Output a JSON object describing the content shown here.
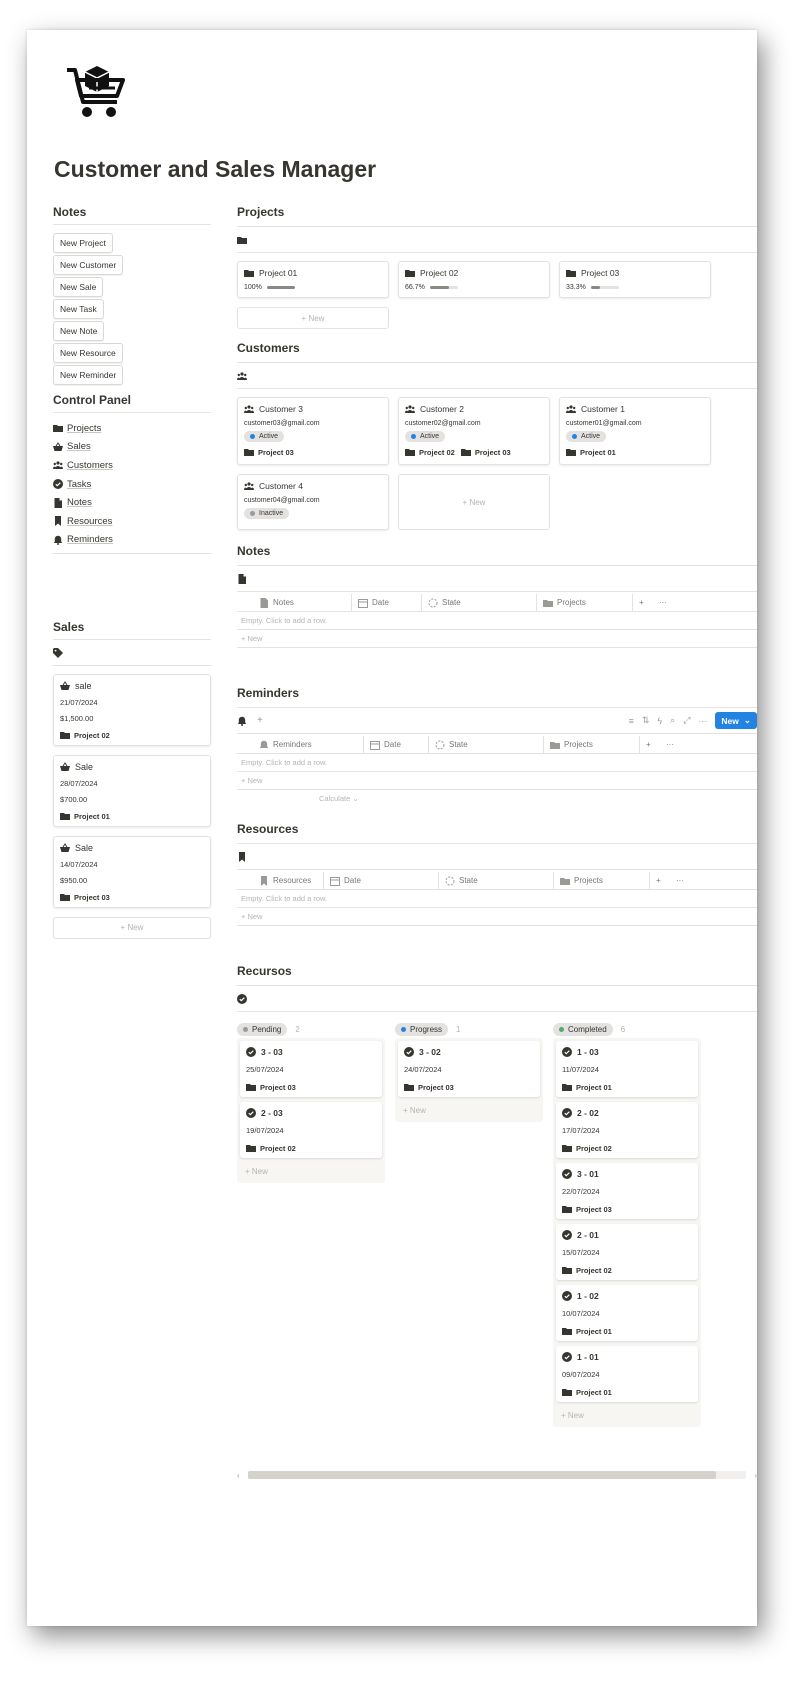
{
  "page": {
    "title": "Customer and Sales Manager"
  },
  "notes_panel": {
    "heading": "Notes",
    "buttons": [
      "New Project",
      "New Customer",
      "New Sale",
      "New Task",
      "New Note",
      "New Resource",
      "New Reminder"
    ]
  },
  "control_panel": {
    "heading": "Control Panel",
    "items": [
      {
        "label": "Projects",
        "icon": "folder-icon"
      },
      {
        "label": "Sales",
        "icon": "basket-icon"
      },
      {
        "label": "Customers",
        "icon": "people-icon"
      },
      {
        "label": "Tasks",
        "icon": "check-circle-icon"
      },
      {
        "label": "Notes",
        "icon": "document-icon"
      },
      {
        "label": "Resources",
        "icon": "bookmark-icon"
      },
      {
        "label": "Reminders",
        "icon": "bell-icon"
      }
    ]
  },
  "sales": {
    "heading": "Sales",
    "cards": [
      {
        "title": "sale",
        "date": "21/07/2024",
        "amount": "$1,500.00",
        "project": "Project 02"
      },
      {
        "title": "Sale",
        "date": "28/07/2024",
        "amount": "$700.00",
        "project": "Project 01"
      },
      {
        "title": "Sale",
        "date": "14/07/2024",
        "amount": "$950.00",
        "project": "Project 03"
      }
    ],
    "new_label": "+ New"
  },
  "projects": {
    "heading": "Projects",
    "cards": [
      {
        "title": "Project 01",
        "progress_label": "100%",
        "progress": 1.0
      },
      {
        "title": "Project 02",
        "progress_label": "66.7%",
        "progress": 0.667
      },
      {
        "title": "Project 03",
        "progress_label": "33.3%",
        "progress": 0.333
      }
    ],
    "new_label": "+ New"
  },
  "customers": {
    "heading": "Customers",
    "cards": [
      {
        "title": "Customer 3",
        "email": "customer03@gmail.com",
        "status": "Active",
        "projects": [
          "Project 03"
        ]
      },
      {
        "title": "Customer 2",
        "email": "customer02@gmail.com",
        "status": "Active",
        "projects": [
          "Project 02",
          "Project 03"
        ]
      },
      {
        "title": "Customer 1",
        "email": "customer01@gmail.com",
        "status": "Active",
        "projects": [
          "Project 01"
        ]
      },
      {
        "title": "Customer 4",
        "email": "customer04@gmail.com",
        "status": "Inactive",
        "projects": []
      }
    ],
    "new_label": "+ New"
  },
  "notes_db": {
    "heading": "Notes",
    "columns": [
      "Notes",
      "Date",
      "State",
      "Projects"
    ],
    "empty": "Empty. Click to add a row.",
    "new_label": "+ New"
  },
  "reminders_db": {
    "heading": "Reminders",
    "columns": [
      "Reminders",
      "Date",
      "State",
      "Projects"
    ],
    "empty": "Empty. Click to add a row.",
    "new_label": "+ New",
    "calculate": "Calculate",
    "new_button": "New"
  },
  "resources_db": {
    "heading": "Resources",
    "columns": [
      "Resources",
      "Date",
      "State",
      "Projects"
    ],
    "empty": "Empty. Click to add a row.",
    "new_label": "+ New"
  },
  "recursos": {
    "heading": "Recursos",
    "columns": [
      {
        "name": "Pending",
        "count": "2",
        "dot": "#9b9a97",
        "cards": [
          {
            "title": "3 - 03",
            "date": "25/07/2024",
            "project": "Project 03"
          },
          {
            "title": "2 - 03",
            "date": "19/07/2024",
            "project": "Project 02"
          }
        ]
      },
      {
        "name": "Progress",
        "count": "1",
        "dot": "#2383e2",
        "cards": [
          {
            "title": "3 - 02",
            "date": "24/07/2024",
            "project": "Project 03"
          }
        ]
      },
      {
        "name": "Completed",
        "count": "6",
        "dot": "#4dab6d",
        "cards": [
          {
            "title": "1 - 03",
            "date": "11/07/2024",
            "project": "Project 01"
          },
          {
            "title": "2 - 02",
            "date": "17/07/2024",
            "project": "Project 02"
          },
          {
            "title": "3 - 01",
            "date": "22/07/2024",
            "project": "Project 03"
          },
          {
            "title": "2 - 01",
            "date": "15/07/2024",
            "project": "Project 02"
          },
          {
            "title": "1 - 02",
            "date": "10/07/2024",
            "project": "Project 01"
          },
          {
            "title": "1 - 01",
            "date": "09/07/2024",
            "project": "Project 01"
          }
        ]
      }
    ],
    "new_label": "+ New"
  },
  "colors": {
    "accent": "#2383e2",
    "active_dot": "#2383e2",
    "inactive_dot": "#9b9a97"
  }
}
